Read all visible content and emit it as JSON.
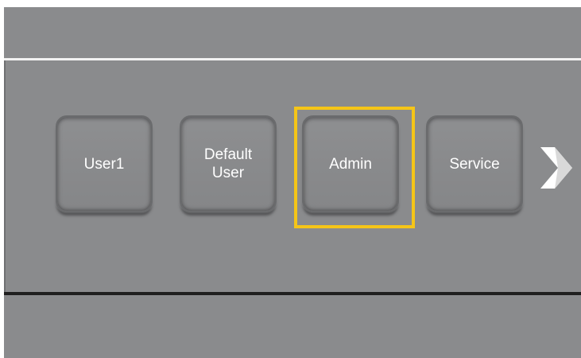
{
  "users": [
    {
      "id": "user1",
      "label": "User1"
    },
    {
      "id": "default",
      "label": "Default\nUser"
    },
    {
      "id": "admin",
      "label": "Admin"
    },
    {
      "id": "service",
      "label": "Service"
    }
  ],
  "selected_user": "Admin",
  "navigation": {
    "next_icon": "chevron-right-icon"
  },
  "colors": {
    "background": "#8a8b8d",
    "selection": "#f5c518",
    "text": "#ffffff",
    "top_divider": "#f2f2f2",
    "bottom_divider": "#1f1f1f"
  }
}
